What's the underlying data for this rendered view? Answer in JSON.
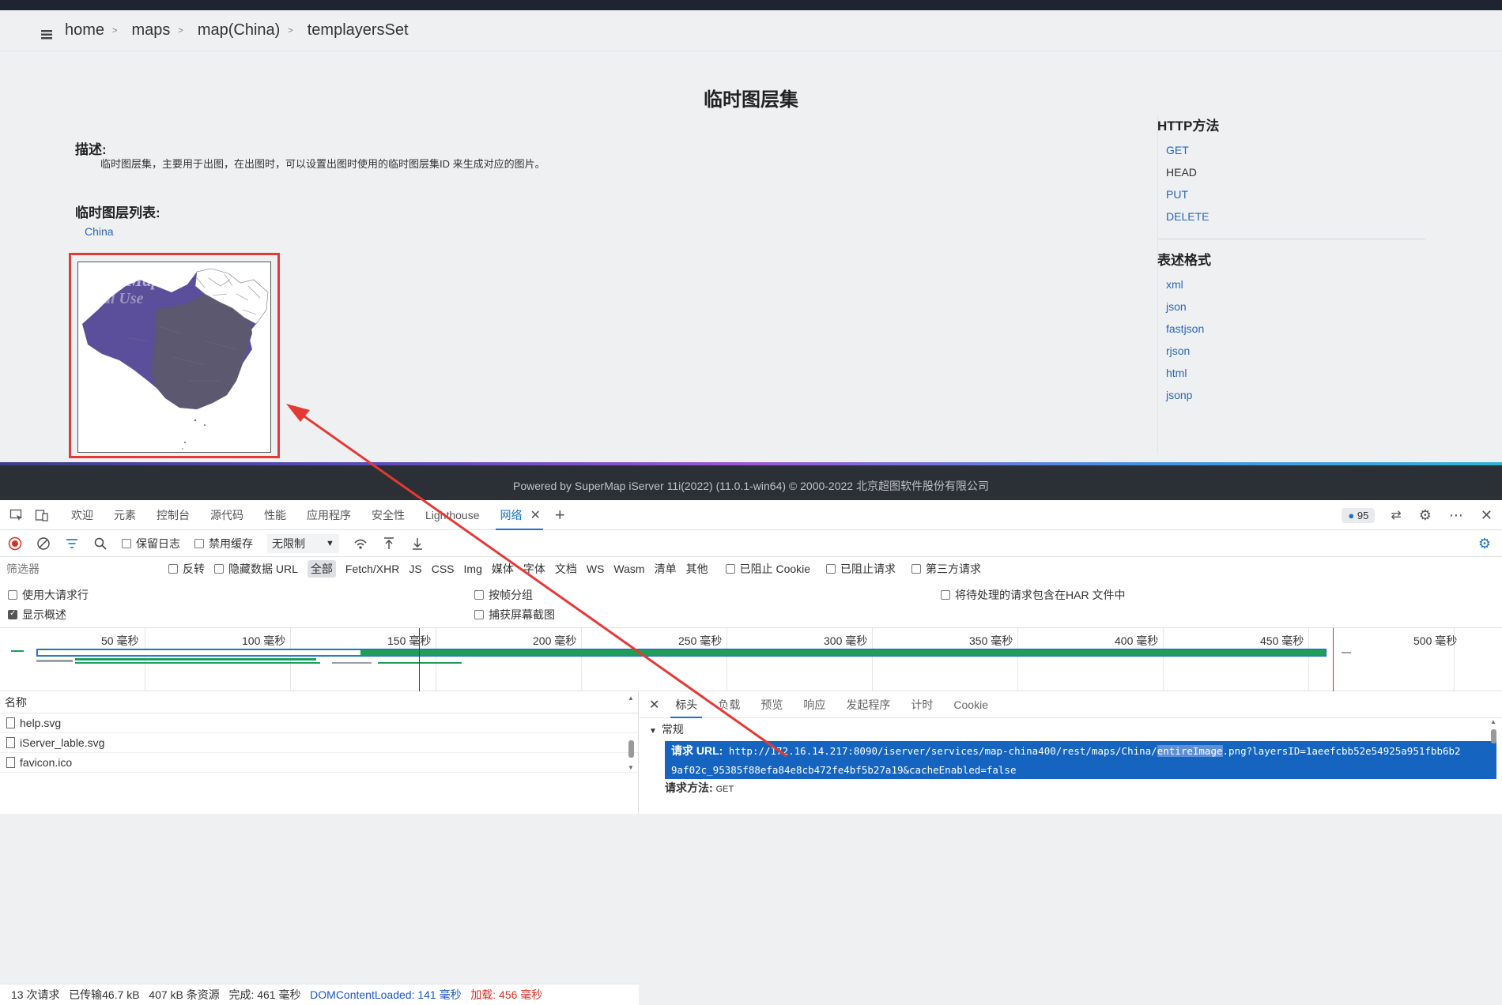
{
  "breadcrumb": {
    "items": [
      "home",
      "maps",
      "map(China)",
      "templayersSet"
    ]
  },
  "page": {
    "title": "临时图层集",
    "desc_heading": "描述:",
    "desc_text": "临时图层集，主要用于出图，在出图时，可以设置出图时使用的临时图层集ID 来生成对应的图片。",
    "list_heading": "临时图层列表:",
    "list_items": [
      "China"
    ],
    "preview_watermark": "SuperMap Trial Use"
  },
  "side": {
    "http_heading": "HTTP方法",
    "http_methods": [
      "GET",
      "HEAD",
      "PUT",
      "DELETE"
    ],
    "format_heading": "表述格式",
    "formats": [
      "xml",
      "json",
      "fastjson",
      "rjson",
      "html",
      "jsonp"
    ]
  },
  "footer": {
    "text": "Powered by SuperMap iServer 11i(2022) (11.0.1-win64) © 2000-2022 北京超图软件股份有限公司"
  },
  "devtools": {
    "tabs": [
      "欢迎",
      "元素",
      "控制台",
      "源代码",
      "性能",
      "应用程序",
      "安全性",
      "Lighthouse",
      "网络"
    ],
    "issues_count": "95",
    "toolbar": {
      "preserve_log": "保留日志",
      "disable_cache": "禁用缓存",
      "throttle": "无限制"
    },
    "filter": {
      "placeholder": "筛选器",
      "invert": "反转",
      "hide_data_urls": "隐藏数据 URL",
      "types": [
        "全部",
        "Fetch/XHR",
        "JS",
        "CSS",
        "Img",
        "媒体",
        "字体",
        "文档",
        "WS",
        "Wasm",
        "清单",
        "其他"
      ],
      "blocked_cookies": "已阻止 Cookie",
      "blocked_requests": "已阻止请求",
      "third_party": "第三方请求"
    },
    "options": {
      "large_rows": "使用大请求行",
      "group_by_frame": "按帧分组",
      "har_pending": "将待处理的请求包含在HAR 文件中",
      "show_overview": "显示概述",
      "capture_screenshots": "捕获屏幕截图"
    },
    "timeline_ticks": [
      "50 毫秒",
      "100 毫秒",
      "150 毫秒",
      "200 毫秒",
      "250 毫秒",
      "300 毫秒",
      "350 毫秒",
      "400 毫秒",
      "450 毫秒",
      "500 毫秒"
    ],
    "name_header": "名称",
    "requests": [
      "help.svg",
      "iServer_lable.svg",
      "favicon.ico"
    ],
    "status": {
      "requests": "13 次请求",
      "transferred": "已传输46.7 kB",
      "resources": "407 kB 条资源",
      "finish": "完成: 461 毫秒",
      "dcl_label": "DOMContentLoaded: 141 毫秒",
      "load_label": "加载: 456 毫秒"
    },
    "detail": {
      "tabs": [
        "标头",
        "负载",
        "预览",
        "响应",
        "发起程序",
        "计时",
        "Cookie"
      ],
      "general_heading": "常规",
      "request_url_label": "请求 URL:",
      "request_url_prefix": "http://172.16.14.217:8090/iserver/services/map-china400/rest/maps/China/",
      "request_url_highlight": "entireImage",
      "request_url_suffix": ".png?layersID=1aeefcbb52e54925a951fbb6b2",
      "request_url_line2": "9af02c_95385f88efa84e8cb472fe4bf5b27a19&cacheEnabled=false",
      "request_method_label": "请求方法:",
      "request_method_value": "GET"
    }
  }
}
